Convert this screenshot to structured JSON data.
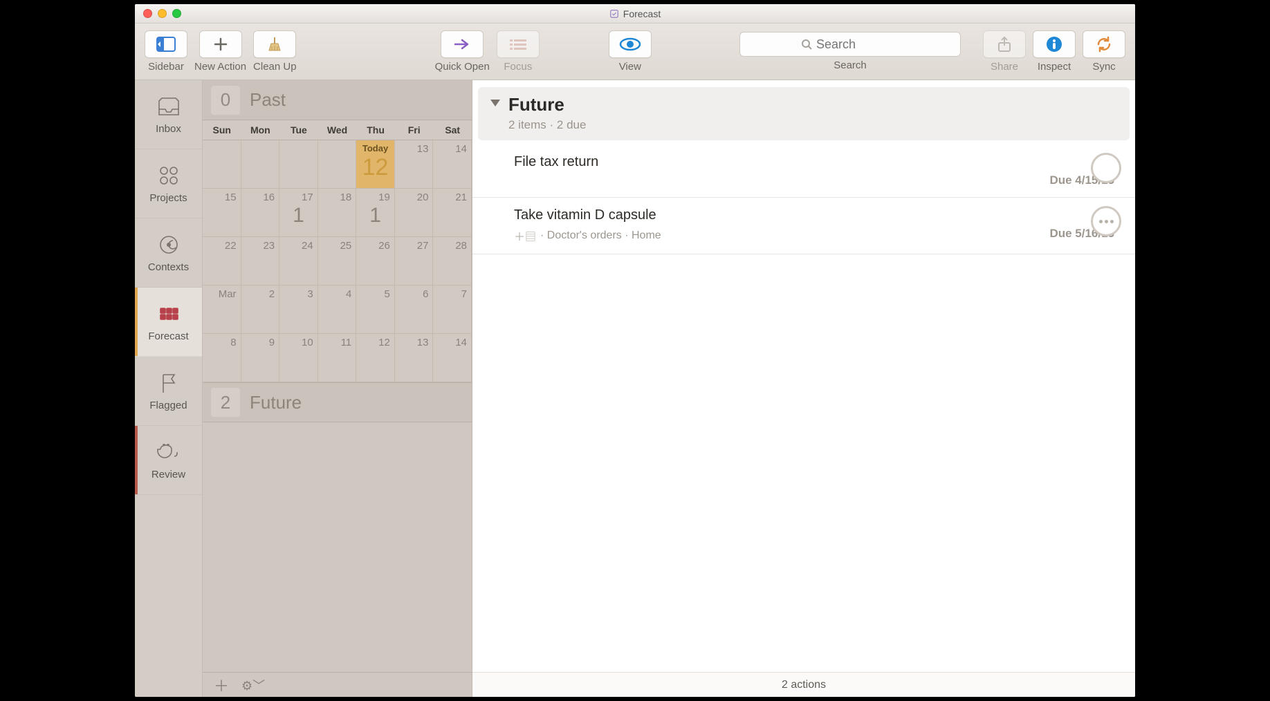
{
  "window": {
    "title": "Forecast"
  },
  "toolbar": {
    "sidebar": "Sidebar",
    "new_action": "New Action",
    "clean_up": "Clean Up",
    "quick_open": "Quick Open",
    "focus": "Focus",
    "view": "View",
    "search_label": "Search",
    "search_placeholder": "Search",
    "share": "Share",
    "inspect": "Inspect",
    "sync": "Sync"
  },
  "sidebar": {
    "items": [
      {
        "label": "Inbox"
      },
      {
        "label": "Projects"
      },
      {
        "label": "Contexts"
      },
      {
        "label": "Forecast"
      },
      {
        "label": "Flagged"
      },
      {
        "label": "Review"
      }
    ]
  },
  "calendar": {
    "past": {
      "count": "0",
      "label": "Past"
    },
    "future": {
      "count": "2",
      "label": "Future"
    },
    "dow": [
      "Sun",
      "Mon",
      "Tue",
      "Wed",
      "Thu",
      "Fri",
      "Sat"
    ],
    "today_label": "Today",
    "today_date": "12",
    "month_label": "Mar",
    "cells_row1": [
      "",
      "",
      "",
      "",
      "Today",
      "13",
      "14"
    ],
    "cells_row2": [
      "15",
      "16",
      "17",
      "18",
      "19",
      "20",
      "21"
    ],
    "row2_counts": {
      "2": "1",
      "4": "1"
    },
    "cells_row3": [
      "22",
      "23",
      "24",
      "25",
      "26",
      "27",
      "28"
    ],
    "cells_row4": [
      "Mar",
      "2",
      "3",
      "4",
      "5",
      "6",
      "7"
    ],
    "cells_row5": [
      "8",
      "9",
      "10",
      "11",
      "12",
      "13",
      "14"
    ]
  },
  "content": {
    "group": {
      "title": "Future",
      "subtitle": "2 items · 2 due"
    },
    "tasks": [
      {
        "title": "File tax return",
        "meta": "",
        "due": "Due 4/15/15",
        "repeat": false
      },
      {
        "title": "Take vitamin D capsule",
        "meta": " · Doctor's orders · Home",
        "due": "Due 5/16/15",
        "repeat": true
      }
    ],
    "footer": "2 actions"
  }
}
